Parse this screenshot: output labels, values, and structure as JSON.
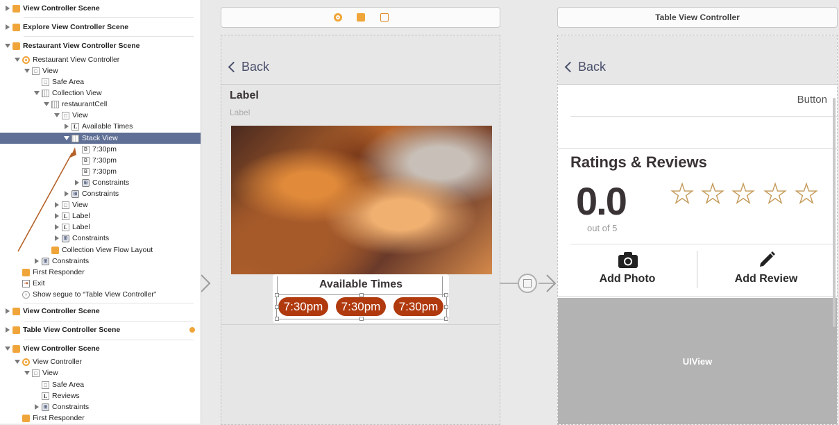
{
  "outline": {
    "items": [
      {
        "label": "View Controller Scene"
      },
      {
        "label": "Explore View Controller Scene"
      },
      {
        "label": "Restaurant View Controller Scene"
      },
      {
        "label": "Restaurant View Controller"
      },
      {
        "label": "View"
      },
      {
        "label": "Safe Area"
      },
      {
        "label": "Collection View"
      },
      {
        "label": "restaurantCell"
      },
      {
        "label": "View"
      },
      {
        "label": "Available Times"
      },
      {
        "label": "Stack View"
      },
      {
        "label": "7:30pm"
      },
      {
        "label": "7:30pm"
      },
      {
        "label": "7:30pm"
      },
      {
        "label": "Constraints"
      },
      {
        "label": "Constraints"
      },
      {
        "label": "View"
      },
      {
        "label": "Label"
      },
      {
        "label": "Label"
      },
      {
        "label": "Constraints"
      },
      {
        "label": "Collection View Flow Layout"
      },
      {
        "label": "Constraints"
      },
      {
        "label": "First Responder"
      },
      {
        "label": "Exit"
      },
      {
        "label": "Show segue to “Table View Controller”"
      },
      {
        "label": "View Controller Scene"
      },
      {
        "label": "Table View Controller Scene"
      },
      {
        "label": "View Controller Scene"
      },
      {
        "label": "View Controller"
      },
      {
        "label": "View"
      },
      {
        "label": "Safe Area"
      },
      {
        "label": "Reviews"
      },
      {
        "label": "Constraints"
      },
      {
        "label": "First Responder"
      }
    ]
  },
  "restaurant_screen": {
    "back_label": "Back",
    "title_label": "Label",
    "subtitle_label": "Label",
    "available_times_title": "Available Times",
    "times": [
      "7:30pm",
      "7:30pm",
      "7:30pm"
    ]
  },
  "table_screen": {
    "header_title": "Table View Controller",
    "back_label": "Back",
    "button_label": "Button",
    "ratings_title": "Ratings & Reviews",
    "rating_value": "0.0",
    "rating_caption": "out of 5",
    "stars": 0,
    "stars_max": 5,
    "add_photo_label": "Add Photo",
    "add_review_label": "Add Review",
    "uiview_label": "UIView"
  },
  "colors": {
    "accent": "#b03a0e",
    "selection": "#5f6f95",
    "scene_icon": "#f0a53a",
    "star_outline": "#c59a5a",
    "arrow": "#b5622a"
  },
  "icons": [
    "camera-icon",
    "pencil-icon",
    "back-chevron-icon",
    "star-icon"
  ]
}
